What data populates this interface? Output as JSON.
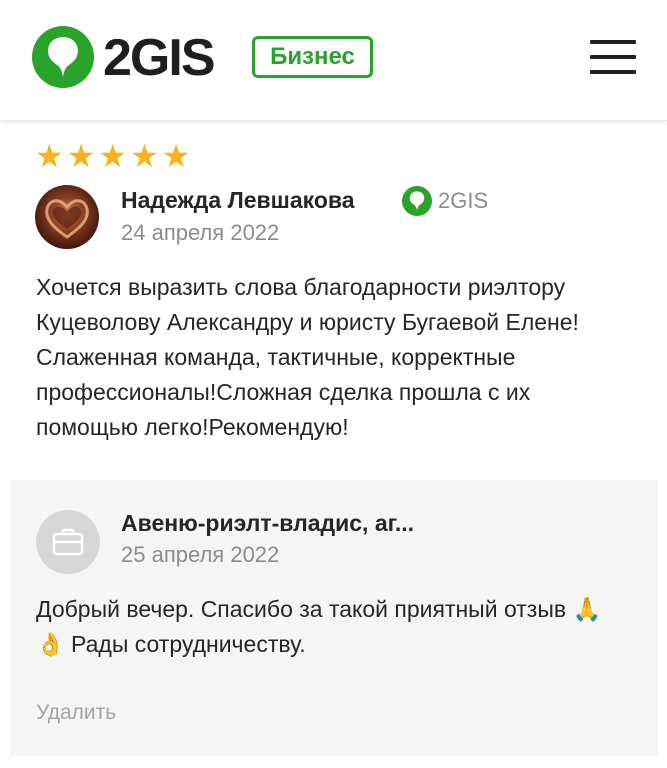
{
  "header": {
    "logo_text": "2GIS",
    "business_badge": "Бизнес",
    "brand_color": "#29a329",
    "menu_icon": "hamburger-menu-icon"
  },
  "review": {
    "rating": 5,
    "rating_max": 5,
    "star_color": "#f9b21c",
    "author": "Надежда Левшакова",
    "source": "2GIS",
    "date": "24 апреля 2022",
    "text": "Хочется выразить слова благодарности риэлтору Куцеволову Александру и юристу Бугаевой Елене!Слаженная команда, тактичные, корректные профессионалы!Сложная сделка прошла с их помощью легко!Рекомендую!"
  },
  "response": {
    "author": "Авеню-риэлт-владис, аг...",
    "avatar_icon": "briefcase-icon",
    "date": "25 апреля 2022",
    "text": "Добрый вечер. Спасибо за такой приятный отзыв 🙏👌 Рады сотрудничеству.",
    "delete_label": "Удалить"
  }
}
